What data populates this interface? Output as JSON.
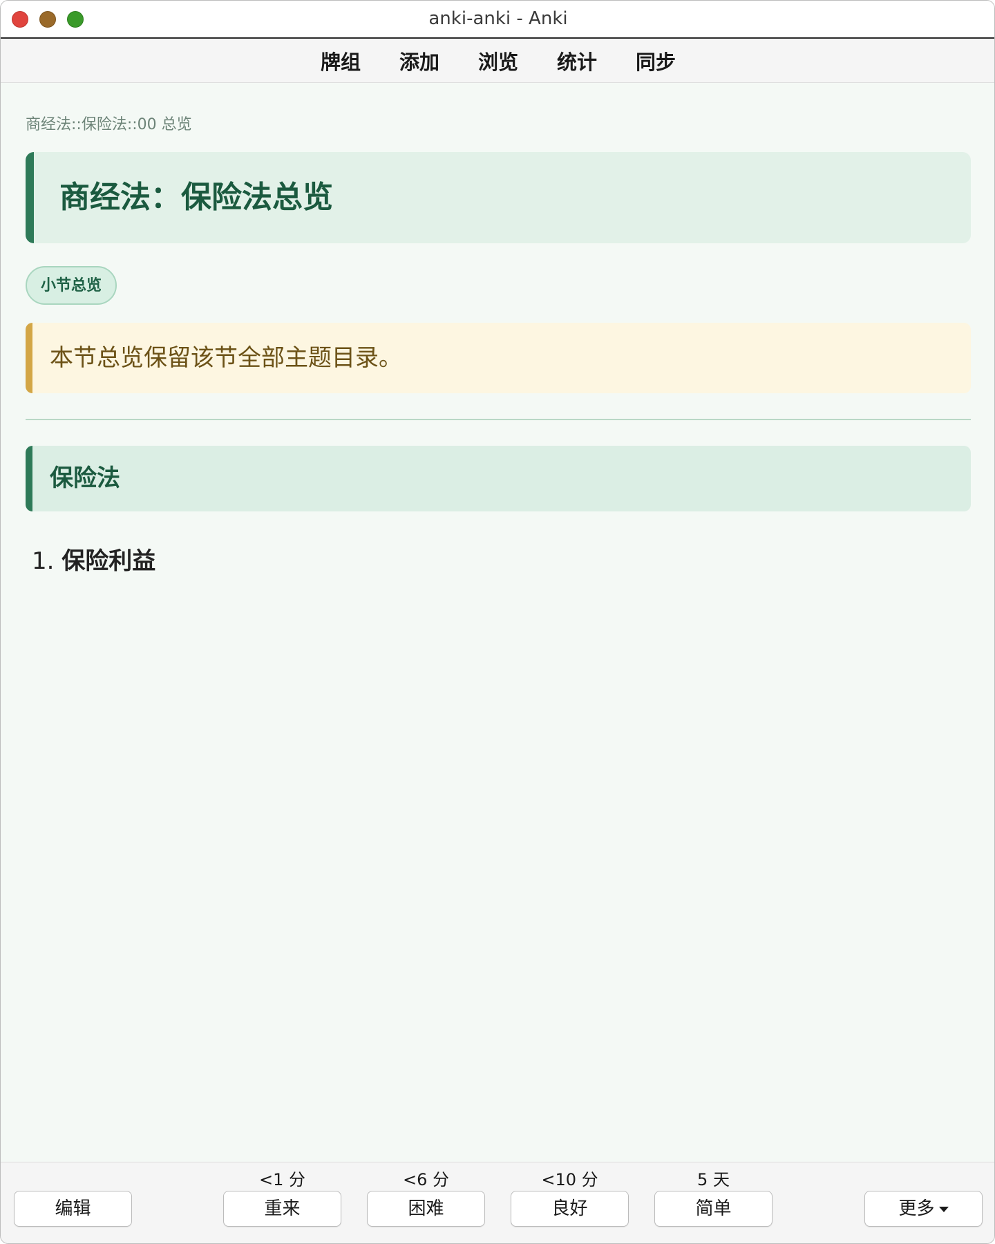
{
  "window": {
    "title": "anki-anki - Anki"
  },
  "toolbar": {
    "items": [
      "牌组",
      "添加",
      "浏览",
      "统计",
      "同步"
    ]
  },
  "card": {
    "breadcrumb": "商经法::保险法::00 总览",
    "title": "商经法：保险法总览",
    "tag": "小节总览",
    "note": "本节总览保留该节全部主题目录。",
    "section_heading": "保险法",
    "list": [
      {
        "number": "1.",
        "text": "保险利益"
      }
    ]
  },
  "bottom": {
    "edit_label": "编辑",
    "more_label": "更多",
    "answers": [
      {
        "interval": "<1 分",
        "label": "重来"
      },
      {
        "interval": "<6 分",
        "label": "困难"
      },
      {
        "interval": "<10 分",
        "label": "良好"
      },
      {
        "interval": "5 天",
        "label": "简单"
      }
    ]
  }
}
